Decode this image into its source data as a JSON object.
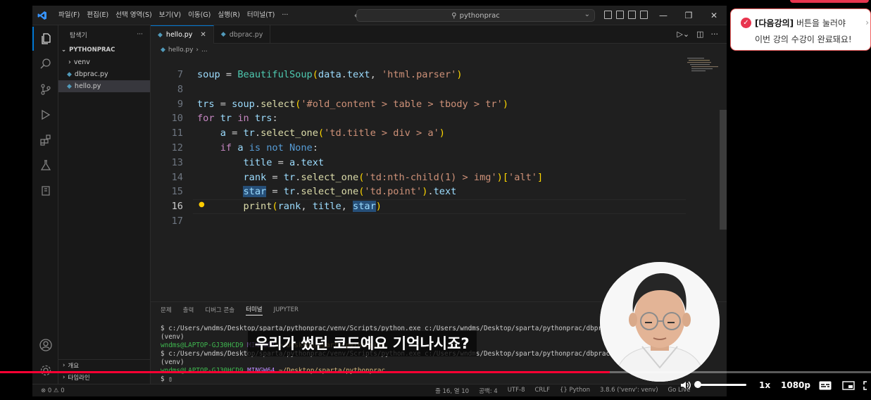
{
  "menu": [
    "파일(F)",
    "편집(E)",
    "선택 영역(S)",
    "보기(V)",
    "이동(G)",
    "실행(R)",
    "터미널(T)",
    "···"
  ],
  "command_center": "pythonprac",
  "sidebar": {
    "title": "탐색기",
    "project": "PYTHONPRAC",
    "items": [
      {
        "label": "venv",
        "type": "folder"
      },
      {
        "label": "dbprac.py",
        "type": "py"
      },
      {
        "label": "hello.py",
        "type": "py"
      }
    ],
    "bottom_sections": [
      "개요",
      "타임라인"
    ]
  },
  "tabs": [
    {
      "label": "hello.py",
      "active": true
    },
    {
      "label": "dbprac.py",
      "active": false
    }
  ],
  "breadcrumb": [
    "hello.py",
    "..."
  ],
  "code_lines": [
    {
      "n": "7",
      "tokens": [
        [
          "var",
          "soup"
        ],
        [
          "plain",
          " = "
        ],
        [
          "cls",
          "BeautifulSoup"
        ],
        [
          "pn",
          "("
        ],
        [
          "var",
          "data"
        ],
        [
          "plain",
          "."
        ],
        [
          "var",
          "text"
        ],
        [
          "plain",
          ", "
        ],
        [
          "str",
          "'html.parser'"
        ],
        [
          "pn",
          ")"
        ]
      ]
    },
    {
      "n": "8",
      "tokens": []
    },
    {
      "n": "9",
      "tokens": [
        [
          "var",
          "trs"
        ],
        [
          "plain",
          " = "
        ],
        [
          "var",
          "soup"
        ],
        [
          "plain",
          "."
        ],
        [
          "fn",
          "select"
        ],
        [
          "pn",
          "("
        ],
        [
          "str",
          "'#old_content > table > tbody > tr'"
        ],
        [
          "pn",
          ")"
        ]
      ]
    },
    {
      "n": "10",
      "tokens": [
        [
          "kw",
          "for"
        ],
        [
          "plain",
          " "
        ],
        [
          "var",
          "tr"
        ],
        [
          "plain",
          " "
        ],
        [
          "kw",
          "in"
        ],
        [
          "plain",
          " "
        ],
        [
          "var",
          "trs"
        ],
        [
          "plain",
          ":"
        ]
      ]
    },
    {
      "n": "11",
      "tokens": [
        [
          "plain",
          "    "
        ],
        [
          "var",
          "a"
        ],
        [
          "plain",
          " = "
        ],
        [
          "var",
          "tr"
        ],
        [
          "plain",
          "."
        ],
        [
          "fn",
          "select_one"
        ],
        [
          "pn",
          "("
        ],
        [
          "str",
          "'td.title > div > a'"
        ],
        [
          "pn",
          ")"
        ]
      ]
    },
    {
      "n": "12",
      "tokens": [
        [
          "plain",
          "    "
        ],
        [
          "kw",
          "if"
        ],
        [
          "plain",
          " "
        ],
        [
          "var",
          "a"
        ],
        [
          "plain",
          " "
        ],
        [
          "kw2",
          "is"
        ],
        [
          "plain",
          " "
        ],
        [
          "kw2",
          "not"
        ],
        [
          "plain",
          " "
        ],
        [
          "kw2",
          "None"
        ],
        [
          "plain",
          ":"
        ]
      ]
    },
    {
      "n": "13",
      "tokens": [
        [
          "plain",
          "        "
        ],
        [
          "var",
          "title"
        ],
        [
          "plain",
          " = "
        ],
        [
          "var",
          "a"
        ],
        [
          "plain",
          "."
        ],
        [
          "var",
          "text"
        ]
      ]
    },
    {
      "n": "14",
      "tokens": [
        [
          "plain",
          "        "
        ],
        [
          "var",
          "rank"
        ],
        [
          "plain",
          " = "
        ],
        [
          "var",
          "tr"
        ],
        [
          "plain",
          "."
        ],
        [
          "fn",
          "select_one"
        ],
        [
          "pn",
          "("
        ],
        [
          "str",
          "'td:nth-child(1) > img'"
        ],
        [
          "pn",
          ")"
        ],
        [
          "pn",
          "["
        ],
        [
          "str",
          "'alt'"
        ],
        [
          "pn",
          "]"
        ]
      ]
    },
    {
      "n": "15",
      "tokens": [
        [
          "plain",
          "        "
        ],
        [
          "var hl",
          "star"
        ],
        [
          "plain",
          " = "
        ],
        [
          "var",
          "tr"
        ],
        [
          "plain",
          "."
        ],
        [
          "fn",
          "select_one"
        ],
        [
          "pn",
          "("
        ],
        [
          "str",
          "'td.point'"
        ],
        [
          "pn",
          ")"
        ],
        [
          "plain",
          "."
        ],
        [
          "var",
          "text"
        ]
      ]
    },
    {
      "n": "16",
      "tokens": [
        [
          "plain",
          "        "
        ],
        [
          "fn",
          "print"
        ],
        [
          "pn",
          "("
        ],
        [
          "var",
          "rank"
        ],
        [
          "plain",
          ", "
        ],
        [
          "var",
          "title"
        ],
        [
          "plain",
          ", "
        ],
        [
          "var hl",
          "star"
        ],
        [
          "pn",
          ")"
        ]
      ],
      "current": true
    },
    {
      "n": "17",
      "tokens": []
    }
  ],
  "panel": {
    "tabs": [
      "문제",
      "출력",
      "디버그 콘솔",
      "터미널",
      "JUPYTER"
    ],
    "active_tab": "터미널",
    "terminal": [
      [
        [
          "plain",
          "$ c:/Users/wndms/Desktop/sparta/pythonprac/venv/Scripts/python.exe c:/Users/wndms/Desktop/sparta/pythonprac/dbprac.py"
        ]
      ],
      [
        [
          "plain",
          "(venv)"
        ]
      ],
      [
        [
          "t-green",
          "wndms@LAPTOP-GJ30HCD9 "
        ],
        [
          "t-purple",
          "MINGW64 "
        ],
        [
          "t-yellow",
          "~/Desktop/sparta/pythonprac"
        ]
      ],
      [
        [
          "plain",
          "$ c:/Users/wndms/Desktop/sparta/pythonprac/venv/Scripts/python.exe c:/Users/wndms/Desktop/sparta/pythonprac/dbprac.py"
        ]
      ],
      [
        [
          "plain",
          "(venv)"
        ]
      ],
      [
        [
          "t-green",
          "wndms@LAPTOP-GJ30HCD9 "
        ],
        [
          "t-purple",
          "MINGW64 "
        ],
        [
          "t-yellow",
          "~/Desktop/sparta/pythonprac"
        ]
      ],
      [
        [
          "plain",
          "$ ▯"
        ]
      ]
    ]
  },
  "statusbar": {
    "left": "⊗ 0 ⚠ 0",
    "right": [
      "줄 16, 열 10",
      "공백: 4",
      "UTF-8",
      "CRLF",
      "{} Python",
      "3.8.6 ('venv': venv)",
      "Go Live"
    ]
  },
  "overlay": {
    "notice_bracket": "[다음강의]",
    "notice_rest": " 버튼을 눌러야",
    "notice_line2": "이번 강의 수강이 완료돼요!",
    "caption": "우리가 썼던 코드예요 기억나시죠?",
    "speed": "1x",
    "quality": "1080p",
    "progress": 0.7,
    "accent": "#e8344e"
  }
}
